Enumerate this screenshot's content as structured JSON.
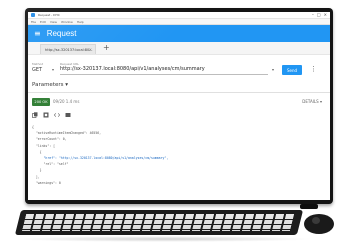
{
  "window": {
    "title": "Request - DHC"
  },
  "menu": [
    "File",
    "Edit",
    "View",
    "Window",
    "Help"
  ],
  "appbar": {
    "title": "Request"
  },
  "tab": {
    "label": "http://sx-320137:local:80..."
  },
  "request": {
    "method_label": "Method",
    "method": "GET",
    "url_label": "Request URL",
    "url": "http://sx-320137.local:8080/api/v1/analyses/cm/summary"
  },
  "send_label": "Send",
  "params_label": "Parameters",
  "status": {
    "code": "200 OK",
    "time": "09/20  1.4 ms",
    "details": "DETAILS"
  },
  "response_lines": [
    "{",
    "  \"activeRuntimeItemChanged\": 46556,",
    "  \"errorCount\": 0,",
    "  \"links\": [ ",
    "    {",
    "      \"href\": \"http://sx-320137.local:8080/api/v1/analyses/cm/summary\",",
    "      \"rel\": \"self\"",
    "    }",
    "  ],",
    "  \"warnings\": 0"
  ],
  "colors": {
    "accent": "#2196f3",
    "status_ok": "#2e7d32"
  }
}
